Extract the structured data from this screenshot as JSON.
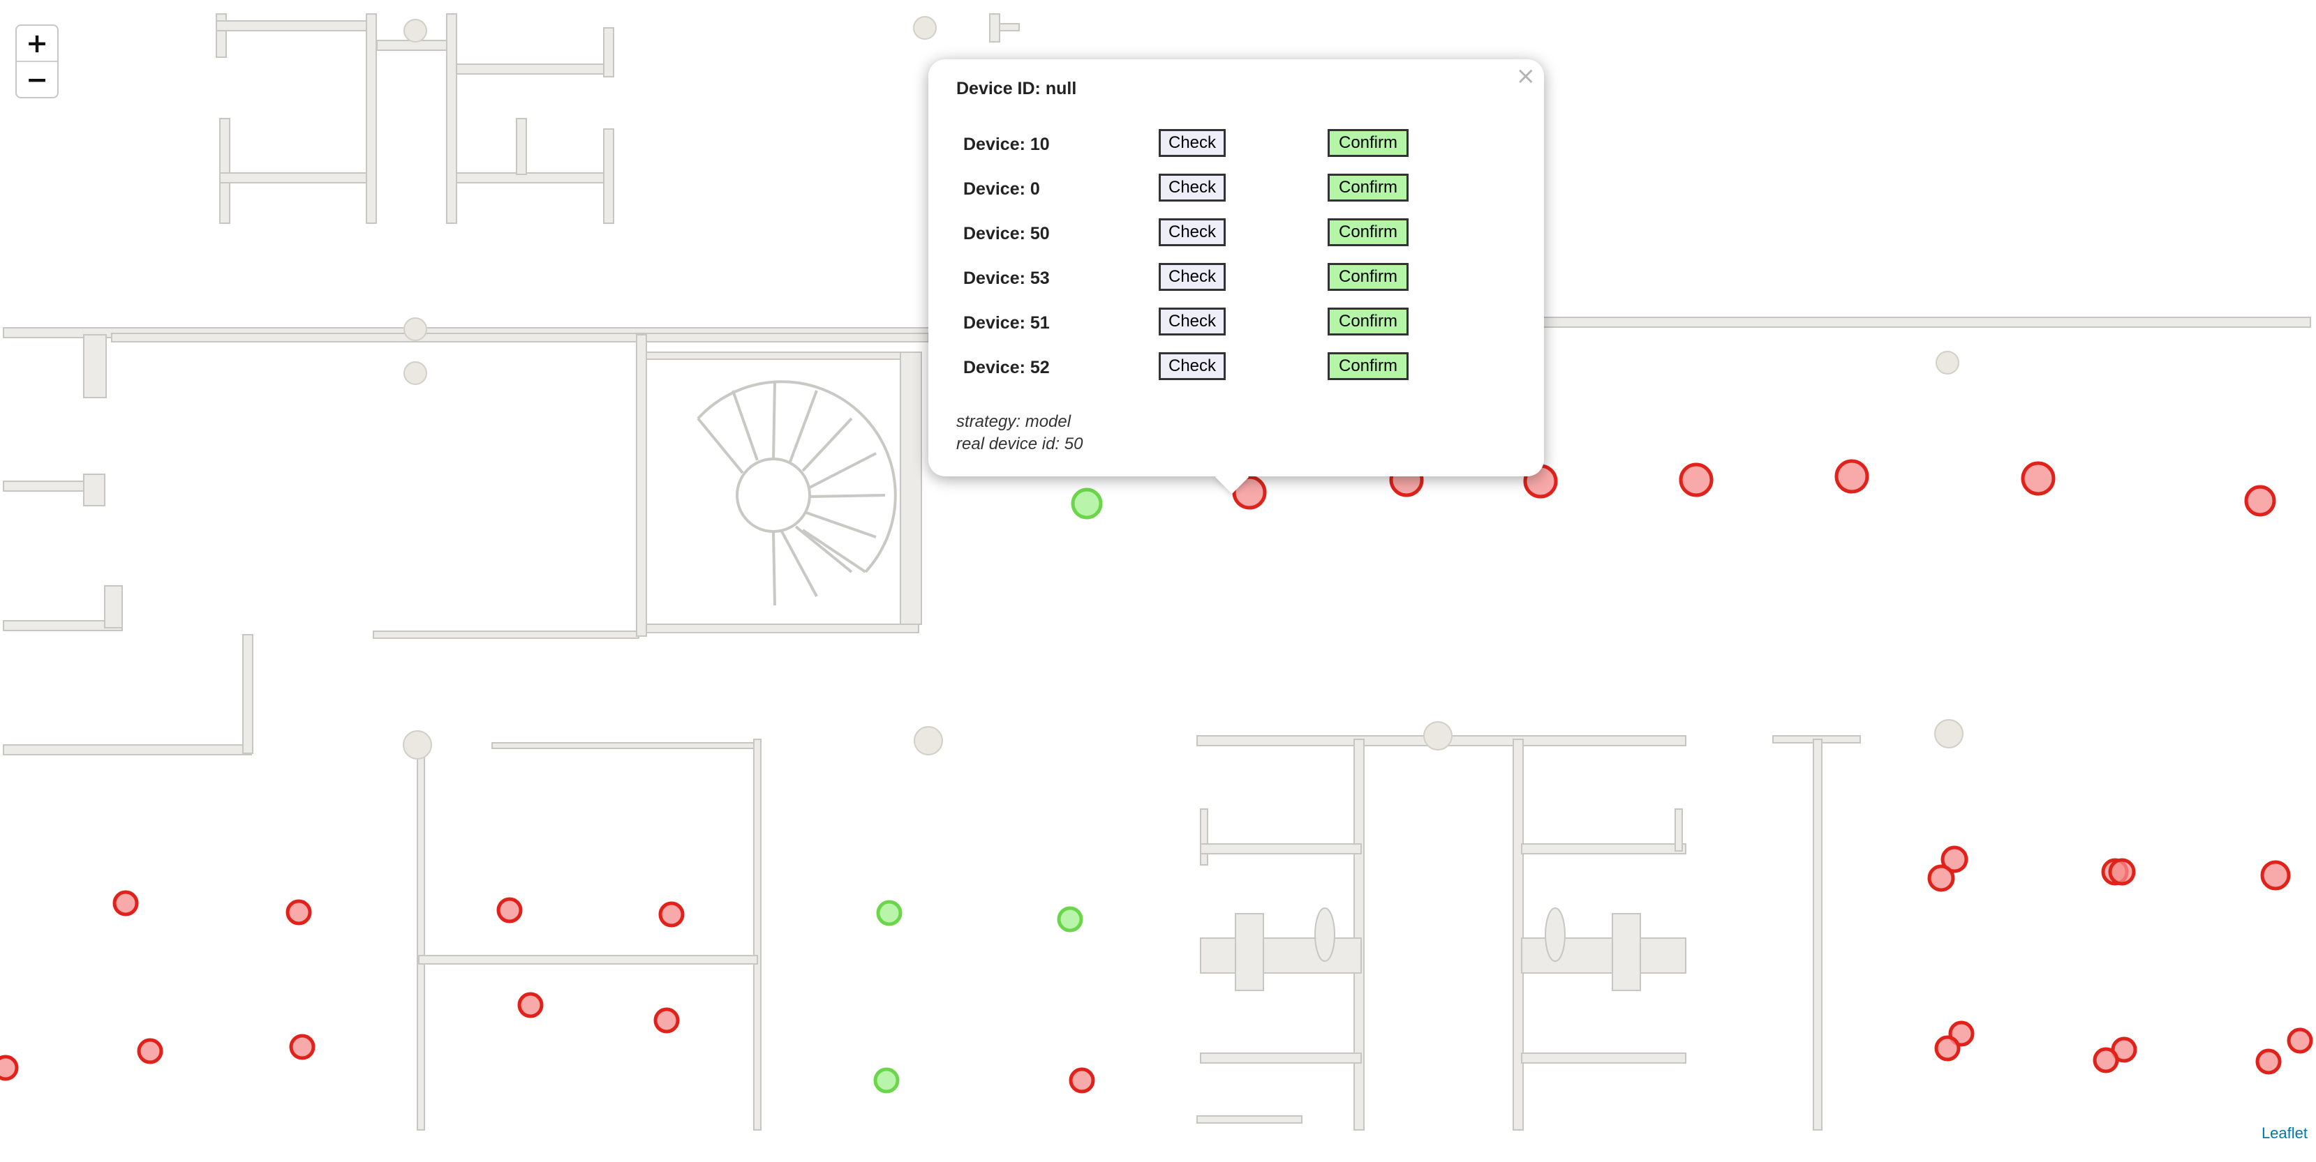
{
  "map": {
    "zoom_in_label": "+",
    "zoom_out_label": "−",
    "attribution": "Leaflet",
    "colors": {
      "marker_red": "#e0221a",
      "marker_green": "#6cd64b",
      "wall": "#ecebe8"
    }
  },
  "popup": {
    "title": "Device ID: null",
    "close_label": "×",
    "devices": [
      {
        "label": "Device: 10",
        "check": "Check",
        "confirm": "Confirm"
      },
      {
        "label": "Device: 0",
        "check": "Check",
        "confirm": "Confirm"
      },
      {
        "label": "Device: 50",
        "check": "Check",
        "confirm": "Confirm"
      },
      {
        "label": "Device: 53",
        "check": "Check",
        "confirm": "Confirm"
      },
      {
        "label": "Device: 51",
        "check": "Check",
        "confirm": "Confirm"
      },
      {
        "label": "Device: 52",
        "check": "Check",
        "confirm": "Confirm"
      }
    ],
    "strategy": "strategy: model",
    "real_device": "real device id: 50"
  }
}
